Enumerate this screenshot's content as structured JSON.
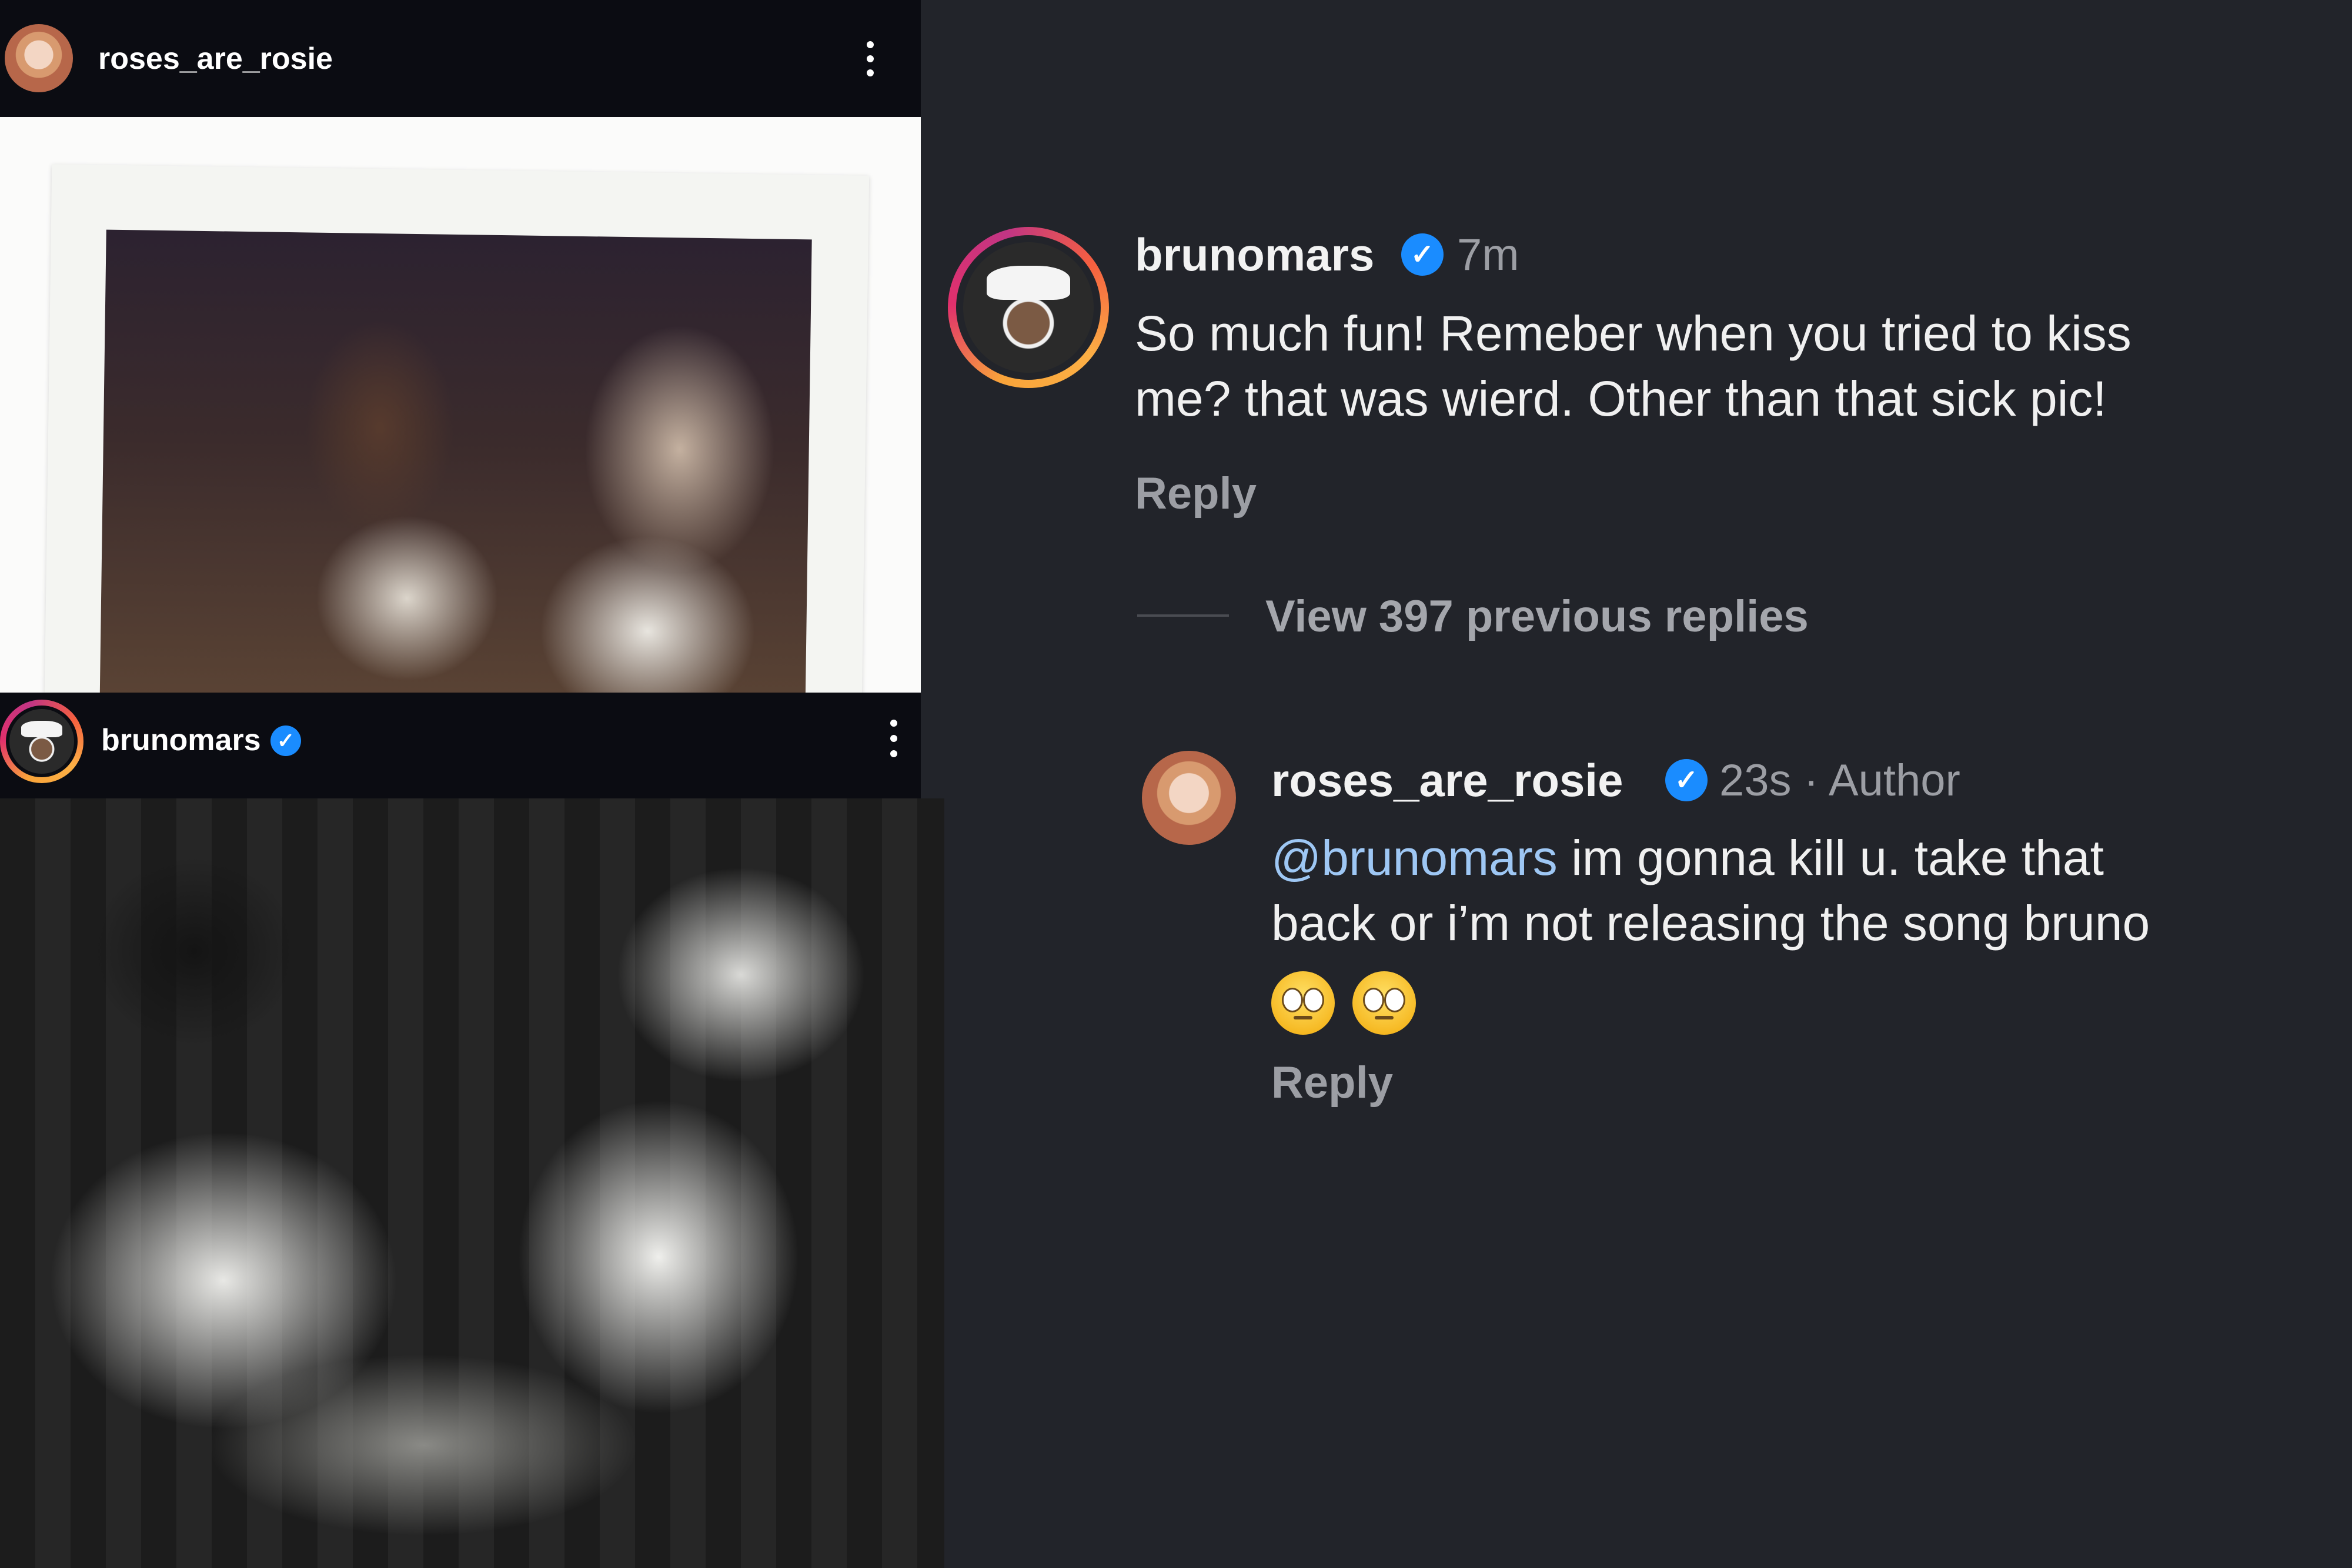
{
  "post1": {
    "username": "roses_are_rosie",
    "avatar_icon": "profile-avatar-rosie",
    "menu_icon": "more-vertical-icon"
  },
  "post2": {
    "username": "brunomars",
    "verified_icon": "verified-badge-icon",
    "avatar_icon": "profile-avatar-bruno-story-ring",
    "menu_icon": "more-vertical-icon"
  },
  "comment": {
    "username": "brunomars",
    "verified_icon": "verified-badge-icon",
    "time": "7m",
    "line1": "So much fun! Remeber when you tried to kiss",
    "line2": "me? that was wierd. Other than that sick pic!",
    "reply_label": "Reply"
  },
  "view_replies": "View 397 previous replies",
  "reply": {
    "username": "roses_are_rosie",
    "verified_icon": "verified-badge-icon",
    "meta": "23s · Author",
    "mention": "@brunomars",
    "line1_rest": " im gonna kill u. take that",
    "line2": "back or i’m not releasing the song bruno",
    "emoji_icon": "face-with-rolling-eyes-emoji",
    "reply_label": "Reply"
  },
  "colors": {
    "background": "#22242a",
    "header": "#0b0c12",
    "verified": "#1a8cff",
    "mention": "#9ec7f4",
    "secondary_text": "#9c9ea4"
  }
}
